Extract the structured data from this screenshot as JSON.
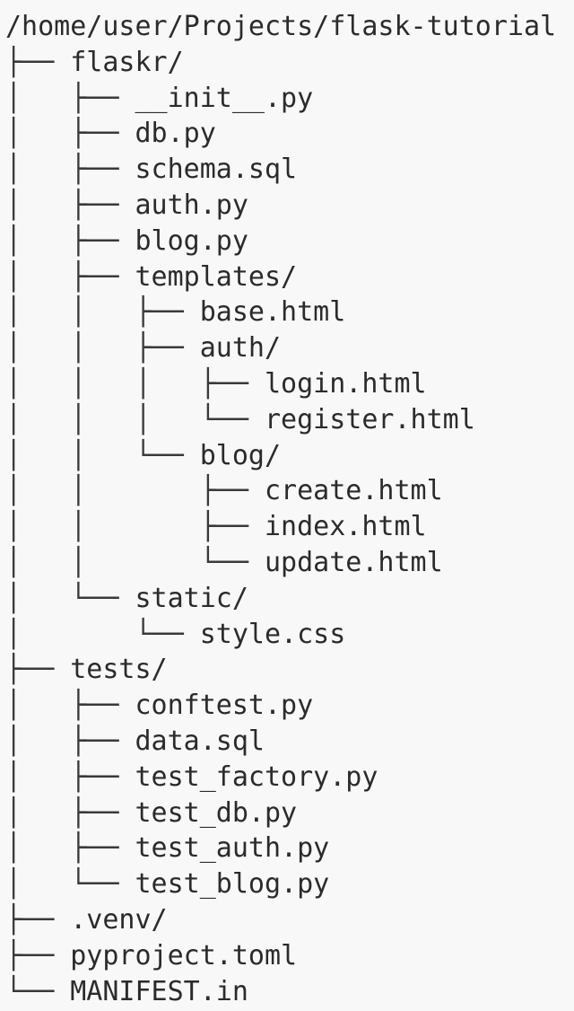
{
  "tree": {
    "root": "/home/user/Projects/flask-tutorial",
    "rows": [
      {
        "prefix": "├── ",
        "name": "flaskr/"
      },
      {
        "prefix": "│   ├── ",
        "name": "__init__.py"
      },
      {
        "prefix": "│   ├── ",
        "name": "db.py"
      },
      {
        "prefix": "│   ├── ",
        "name": "schema.sql"
      },
      {
        "prefix": "│   ├── ",
        "name": "auth.py"
      },
      {
        "prefix": "│   ├── ",
        "name": "blog.py"
      },
      {
        "prefix": "│   ├── ",
        "name": "templates/"
      },
      {
        "prefix": "│   │   ├── ",
        "name": "base.html"
      },
      {
        "prefix": "│   │   ├── ",
        "name": "auth/"
      },
      {
        "prefix": "│   │   │   ├── ",
        "name": "login.html"
      },
      {
        "prefix": "│   │   │   └── ",
        "name": "register.html"
      },
      {
        "prefix": "│   │   └── ",
        "name": "blog/"
      },
      {
        "prefix": "│   │       ├── ",
        "name": "create.html"
      },
      {
        "prefix": "│   │       ├── ",
        "name": "index.html"
      },
      {
        "prefix": "│   │       └── ",
        "name": "update.html"
      },
      {
        "prefix": "│   └── ",
        "name": "static/"
      },
      {
        "prefix": "│       └── ",
        "name": "style.css"
      },
      {
        "prefix": "├── ",
        "name": "tests/"
      },
      {
        "prefix": "│   ├── ",
        "name": "conftest.py"
      },
      {
        "prefix": "│   ├── ",
        "name": "data.sql"
      },
      {
        "prefix": "│   ├── ",
        "name": "test_factory.py"
      },
      {
        "prefix": "│   ├── ",
        "name": "test_db.py"
      },
      {
        "prefix": "│   ├── ",
        "name": "test_auth.py"
      },
      {
        "prefix": "│   └── ",
        "name": "test_blog.py"
      },
      {
        "prefix": "├── ",
        "name": ".venv/"
      },
      {
        "prefix": "├── ",
        "name": "pyproject.toml"
      },
      {
        "prefix": "└── ",
        "name": "MANIFEST.in"
      }
    ]
  },
  "colors": {
    "background": "#f8f8f8",
    "text": "#2b2b2b"
  }
}
